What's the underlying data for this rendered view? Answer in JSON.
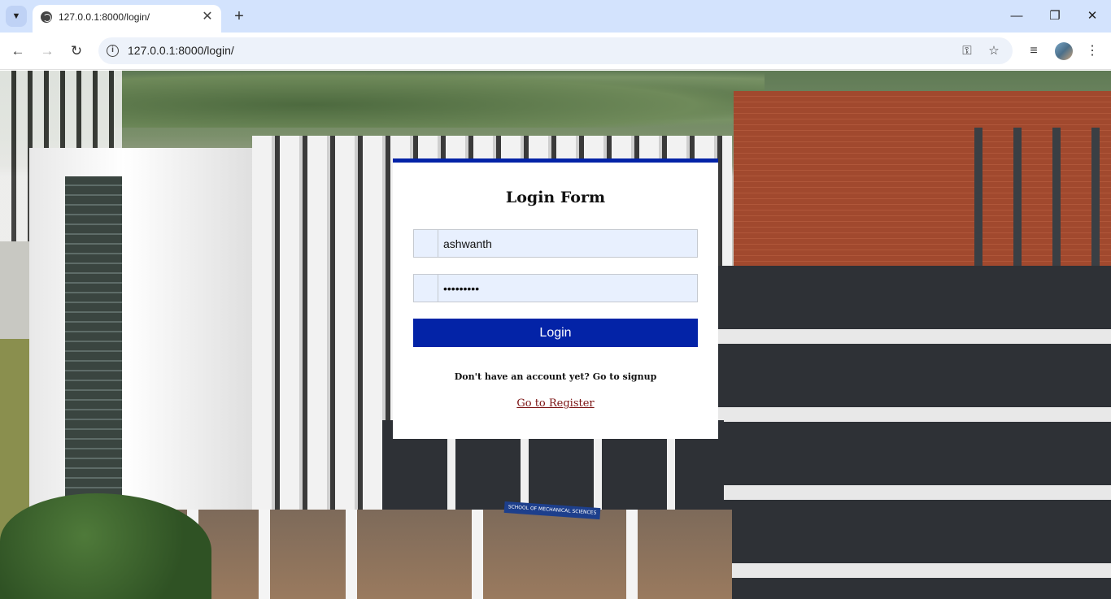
{
  "browser": {
    "tab_title": "127.0.0.1:8000/login/",
    "url": "127.0.0.1:8000/login/",
    "new_tab_label": "+",
    "tab_close_label": "✕"
  },
  "login_form": {
    "title": "Login Form",
    "username_value": "ashwanth",
    "password_value": "•••••••••",
    "login_button_label": "Login",
    "signup_prompt": "Don't have an account yet? Go to signup",
    "register_link_label": "Go to Register"
  },
  "background": {
    "sign_text": "SCHOOL OF MECHANICAL SCIENCES"
  },
  "colors": {
    "accent": "#0323a7",
    "link": "#7a1111",
    "tabbar": "#d3e3fd",
    "input_bg": "#e8f0fe"
  }
}
